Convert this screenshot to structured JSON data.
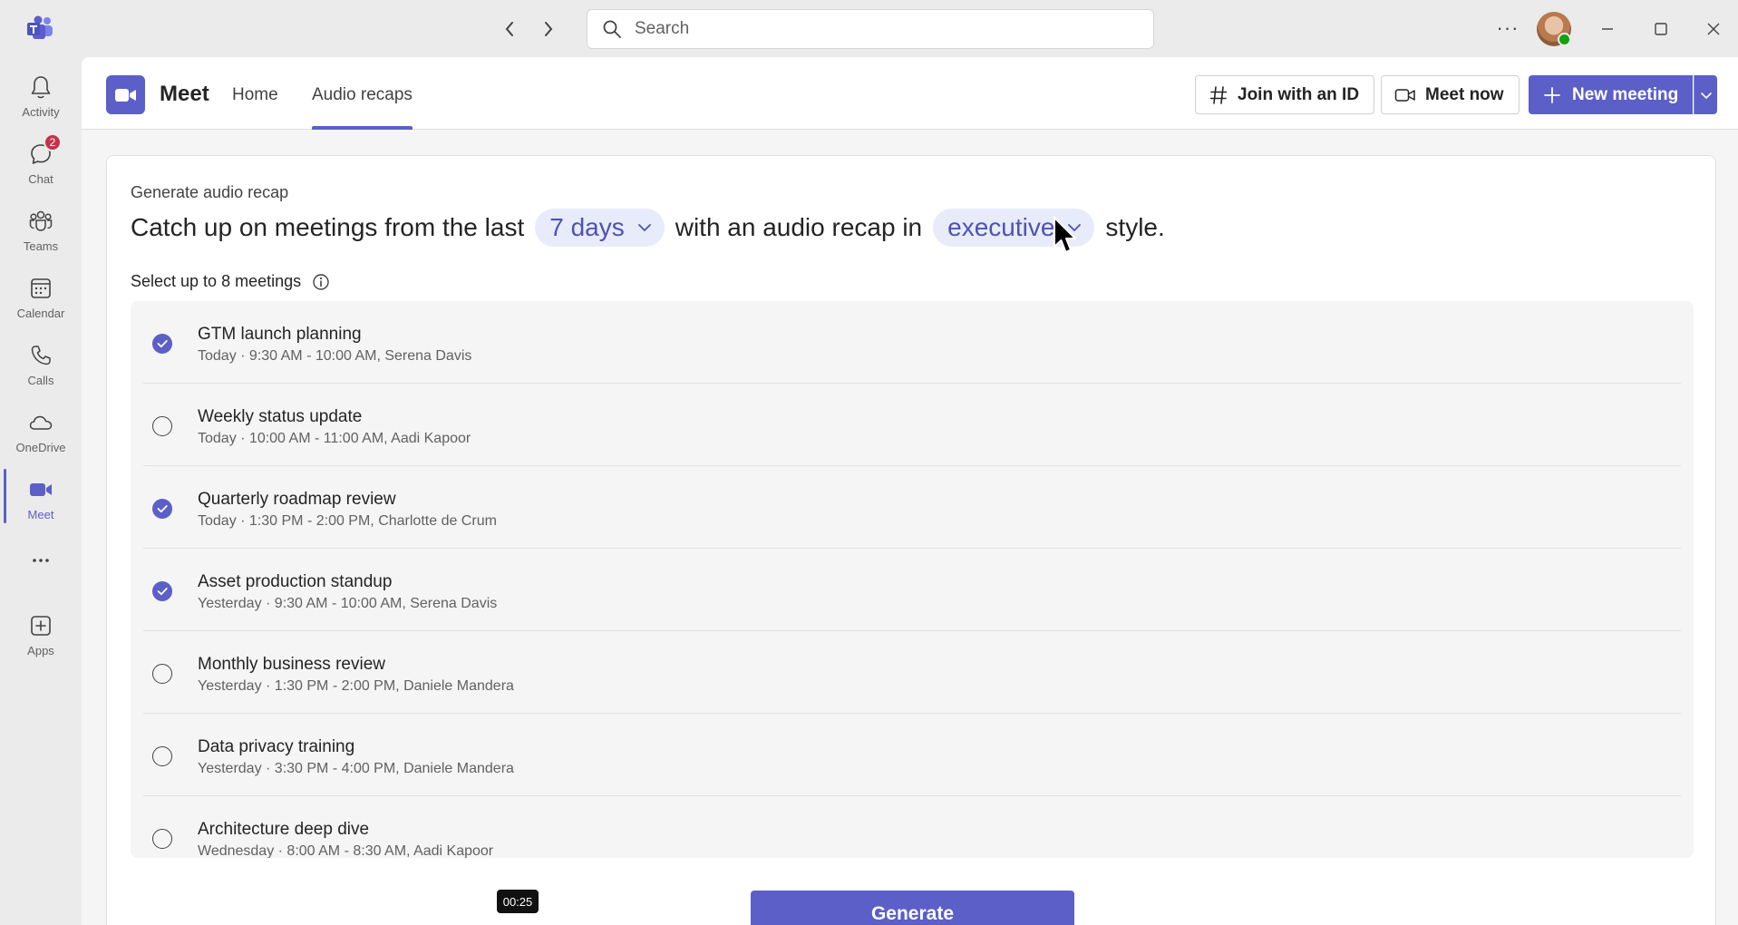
{
  "titlebar": {
    "search_placeholder": "Search"
  },
  "rail": {
    "items": [
      {
        "label": "Activity",
        "icon": "bell-icon"
      },
      {
        "label": "Chat",
        "icon": "chat-icon",
        "badge": "2"
      },
      {
        "label": "Teams",
        "icon": "teams-icon"
      },
      {
        "label": "Calendar",
        "icon": "calendar-icon"
      },
      {
        "label": "Calls",
        "icon": "phone-icon"
      },
      {
        "label": "OneDrive",
        "icon": "cloud-icon"
      },
      {
        "label": "Meet",
        "icon": "video-icon",
        "active": true
      },
      {
        "label": "",
        "icon": "more-icon"
      },
      {
        "label": "Apps",
        "icon": "add-app-icon"
      }
    ]
  },
  "header": {
    "app_title": "Meet",
    "tabs": [
      {
        "label": "Home",
        "active": false
      },
      {
        "label": "Audio recaps",
        "active": true
      }
    ],
    "join_label": "Join with an ID",
    "meet_now_label": "Meet now",
    "new_meeting_label": "New meeting"
  },
  "recap": {
    "card_title": "Generate audio recap",
    "sentence_prefix": "Catch up on meetings from the last",
    "period_value": "7 days",
    "sentence_middle": "with an audio recap in",
    "style_value": "executive",
    "sentence_suffix": "style.",
    "select_label": "Select up to 8 meetings",
    "meetings": [
      {
        "title": "GTM launch planning",
        "subtitle": "Today · 9:30 AM - 10:00 AM, Serena Davis",
        "selected": true
      },
      {
        "title": "Weekly status update",
        "subtitle": "Today · 10:00 AM - 11:00 AM, Aadi Kapoor",
        "selected": false
      },
      {
        "title": "Quarterly roadmap review",
        "subtitle": "Today · 1:30 PM - 2:00 PM, Charlotte de Crum",
        "selected": true
      },
      {
        "title": "Asset production standup",
        "subtitle": "Yesterday · 9:30 AM - 10:00 AM, Serena Davis",
        "selected": true
      },
      {
        "title": "Monthly business review",
        "subtitle": "Yesterday · 1:30 PM - 2:00 PM, Daniele Mandera",
        "selected": false
      },
      {
        "title": "Data privacy training",
        "subtitle": "Yesterday · 3:30 PM - 4:00 PM, Daniele Mandera",
        "selected": false
      },
      {
        "title": "Architecture deep dive",
        "subtitle": "Wednesday · 8:00 AM - 8:30 AM, Aadi Kapoor",
        "selected": false
      }
    ],
    "generate_label": "Generate"
  },
  "overlay": {
    "timer": "00:25"
  },
  "colors": {
    "accent": "#5b5fc7",
    "pill_bg": "#e8ebfa",
    "badge": "#c4314b",
    "presence": "#13a10e"
  }
}
